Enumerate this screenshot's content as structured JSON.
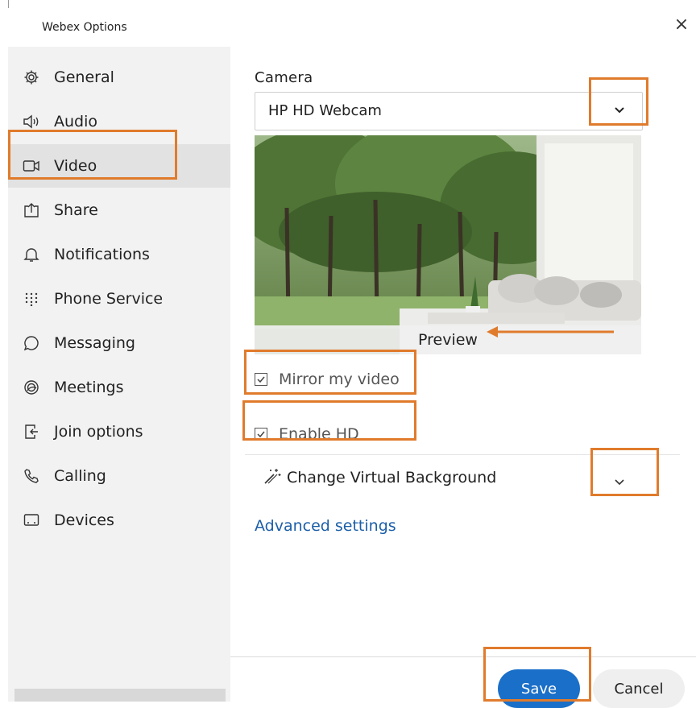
{
  "window": {
    "title": "Webex Options",
    "close_glyph": "×"
  },
  "sidebar": {
    "items": [
      {
        "label": "General",
        "icon": "gear-icon"
      },
      {
        "label": "Audio",
        "icon": "speaker-icon"
      },
      {
        "label": "Video",
        "icon": "video-camera-icon",
        "active": true
      },
      {
        "label": "Share",
        "icon": "share-icon"
      },
      {
        "label": "Notifications",
        "icon": "bell-icon"
      },
      {
        "label": "Phone Service",
        "icon": "keypad-icon"
      },
      {
        "label": "Messaging",
        "icon": "chat-bubble-icon"
      },
      {
        "label": "Meetings",
        "icon": "meetings-icon"
      },
      {
        "label": "Join options",
        "icon": "join-icon"
      },
      {
        "label": "Calling",
        "icon": "phone-handset-icon"
      },
      {
        "label": "Devices",
        "icon": "devices-icon"
      }
    ]
  },
  "video": {
    "camera_label": "Camera",
    "camera_value": "HP HD Webcam",
    "preview_label": "Preview",
    "mirror_label": "Mirror my video",
    "mirror_checked": true,
    "hd_label": "Enable HD",
    "hd_checked": true,
    "virtual_bg_label": "Change Virtual Background",
    "advanced_label": "Advanced settings"
  },
  "footer": {
    "save_label": "Save",
    "cancel_label": "Cancel"
  },
  "colors": {
    "accent": "#1a6fc8",
    "highlight": "#e07b2c",
    "sidebar_bg": "#f2f2f2",
    "active_bg": "#e2e2e2"
  }
}
